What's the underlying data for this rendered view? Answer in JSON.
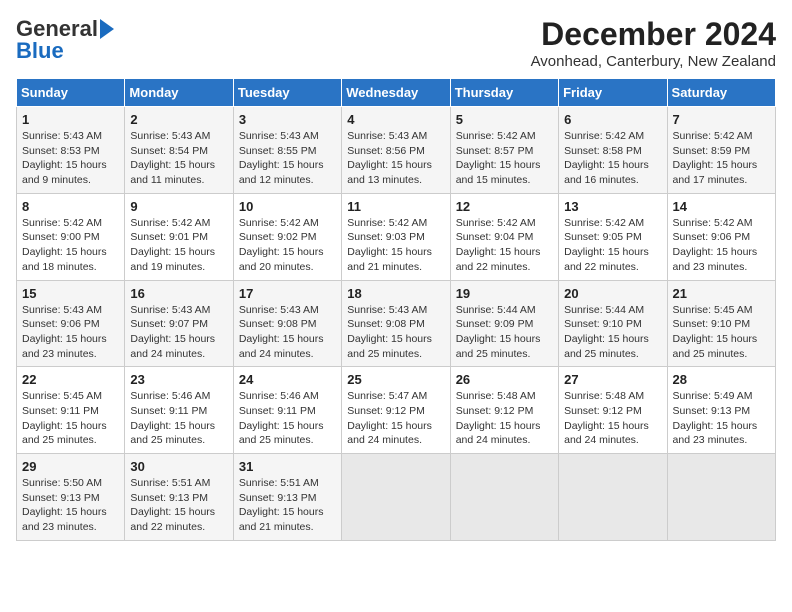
{
  "header": {
    "logo_line1": "General",
    "logo_line2": "Blue",
    "title": "December 2024",
    "subtitle": "Avonhead, Canterbury, New Zealand"
  },
  "calendar": {
    "days_of_week": [
      "Sunday",
      "Monday",
      "Tuesday",
      "Wednesday",
      "Thursday",
      "Friday",
      "Saturday"
    ],
    "weeks": [
      [
        {
          "day": "",
          "empty": true
        },
        {
          "day": "",
          "empty": true
        },
        {
          "day": "",
          "empty": true
        },
        {
          "day": "",
          "empty": true
        },
        {
          "day": "",
          "empty": true
        },
        {
          "day": "",
          "empty": true
        },
        {
          "day": "",
          "empty": true
        }
      ],
      [
        {
          "date": "1",
          "sunrise": "Sunrise: 5:43 AM",
          "sunset": "Sunset: 8:53 PM",
          "daylight": "Daylight: 15 hours and 9 minutes."
        },
        {
          "date": "2",
          "sunrise": "Sunrise: 5:43 AM",
          "sunset": "Sunset: 8:54 PM",
          "daylight": "Daylight: 15 hours and 11 minutes."
        },
        {
          "date": "3",
          "sunrise": "Sunrise: 5:43 AM",
          "sunset": "Sunset: 8:55 PM",
          "daylight": "Daylight: 15 hours and 12 minutes."
        },
        {
          "date": "4",
          "sunrise": "Sunrise: 5:43 AM",
          "sunset": "Sunset: 8:56 PM",
          "daylight": "Daylight: 15 hours and 13 minutes."
        },
        {
          "date": "5",
          "sunrise": "Sunrise: 5:42 AM",
          "sunset": "Sunset: 8:57 PM",
          "daylight": "Daylight: 15 hours and 15 minutes."
        },
        {
          "date": "6",
          "sunrise": "Sunrise: 5:42 AM",
          "sunset": "Sunset: 8:58 PM",
          "daylight": "Daylight: 15 hours and 16 minutes."
        },
        {
          "date": "7",
          "sunrise": "Sunrise: 5:42 AM",
          "sunset": "Sunset: 8:59 PM",
          "daylight": "Daylight: 15 hours and 17 minutes."
        }
      ],
      [
        {
          "date": "8",
          "sunrise": "Sunrise: 5:42 AM",
          "sunset": "Sunset: 9:00 PM",
          "daylight": "Daylight: 15 hours and 18 minutes."
        },
        {
          "date": "9",
          "sunrise": "Sunrise: 5:42 AM",
          "sunset": "Sunset: 9:01 PM",
          "daylight": "Daylight: 15 hours and 19 minutes."
        },
        {
          "date": "10",
          "sunrise": "Sunrise: 5:42 AM",
          "sunset": "Sunset: 9:02 PM",
          "daylight": "Daylight: 15 hours and 20 minutes."
        },
        {
          "date": "11",
          "sunrise": "Sunrise: 5:42 AM",
          "sunset": "Sunset: 9:03 PM",
          "daylight": "Daylight: 15 hours and 21 minutes."
        },
        {
          "date": "12",
          "sunrise": "Sunrise: 5:42 AM",
          "sunset": "Sunset: 9:04 PM",
          "daylight": "Daylight: 15 hours and 22 minutes."
        },
        {
          "date": "13",
          "sunrise": "Sunrise: 5:42 AM",
          "sunset": "Sunset: 9:05 PM",
          "daylight": "Daylight: 15 hours and 22 minutes."
        },
        {
          "date": "14",
          "sunrise": "Sunrise: 5:42 AM",
          "sunset": "Sunset: 9:06 PM",
          "daylight": "Daylight: 15 hours and 23 minutes."
        }
      ],
      [
        {
          "date": "15",
          "sunrise": "Sunrise: 5:43 AM",
          "sunset": "Sunset: 9:06 PM",
          "daylight": "Daylight: 15 hours and 23 minutes."
        },
        {
          "date": "16",
          "sunrise": "Sunrise: 5:43 AM",
          "sunset": "Sunset: 9:07 PM",
          "daylight": "Daylight: 15 hours and 24 minutes."
        },
        {
          "date": "17",
          "sunrise": "Sunrise: 5:43 AM",
          "sunset": "Sunset: 9:08 PM",
          "daylight": "Daylight: 15 hours and 24 minutes."
        },
        {
          "date": "18",
          "sunrise": "Sunrise: 5:43 AM",
          "sunset": "Sunset: 9:08 PM",
          "daylight": "Daylight: 15 hours and 25 minutes."
        },
        {
          "date": "19",
          "sunrise": "Sunrise: 5:44 AM",
          "sunset": "Sunset: 9:09 PM",
          "daylight": "Daylight: 15 hours and 25 minutes."
        },
        {
          "date": "20",
          "sunrise": "Sunrise: 5:44 AM",
          "sunset": "Sunset: 9:10 PM",
          "daylight": "Daylight: 15 hours and 25 minutes."
        },
        {
          "date": "21",
          "sunrise": "Sunrise: 5:45 AM",
          "sunset": "Sunset: 9:10 PM",
          "daylight": "Daylight: 15 hours and 25 minutes."
        }
      ],
      [
        {
          "date": "22",
          "sunrise": "Sunrise: 5:45 AM",
          "sunset": "Sunset: 9:11 PM",
          "daylight": "Daylight: 15 hours and 25 minutes."
        },
        {
          "date": "23",
          "sunrise": "Sunrise: 5:46 AM",
          "sunset": "Sunset: 9:11 PM",
          "daylight": "Daylight: 15 hours and 25 minutes."
        },
        {
          "date": "24",
          "sunrise": "Sunrise: 5:46 AM",
          "sunset": "Sunset: 9:11 PM",
          "daylight": "Daylight: 15 hours and 25 minutes."
        },
        {
          "date": "25",
          "sunrise": "Sunrise: 5:47 AM",
          "sunset": "Sunset: 9:12 PM",
          "daylight": "Daylight: 15 hours and 24 minutes."
        },
        {
          "date": "26",
          "sunrise": "Sunrise: 5:48 AM",
          "sunset": "Sunset: 9:12 PM",
          "daylight": "Daylight: 15 hours and 24 minutes."
        },
        {
          "date": "27",
          "sunrise": "Sunrise: 5:48 AM",
          "sunset": "Sunset: 9:12 PM",
          "daylight": "Daylight: 15 hours and 24 minutes."
        },
        {
          "date": "28",
          "sunrise": "Sunrise: 5:49 AM",
          "sunset": "Sunset: 9:13 PM",
          "daylight": "Daylight: 15 hours and 23 minutes."
        }
      ],
      [
        {
          "date": "29",
          "sunrise": "Sunrise: 5:50 AM",
          "sunset": "Sunset: 9:13 PM",
          "daylight": "Daylight: 15 hours and 23 minutes."
        },
        {
          "date": "30",
          "sunrise": "Sunrise: 5:51 AM",
          "sunset": "Sunset: 9:13 PM",
          "daylight": "Daylight: 15 hours and 22 minutes."
        },
        {
          "date": "31",
          "sunrise": "Sunrise: 5:51 AM",
          "sunset": "Sunset: 9:13 PM",
          "daylight": "Daylight: 15 hours and 21 minutes."
        },
        {
          "day": "",
          "empty": true
        },
        {
          "day": "",
          "empty": true
        },
        {
          "day": "",
          "empty": true
        },
        {
          "day": "",
          "empty": true
        }
      ]
    ]
  }
}
